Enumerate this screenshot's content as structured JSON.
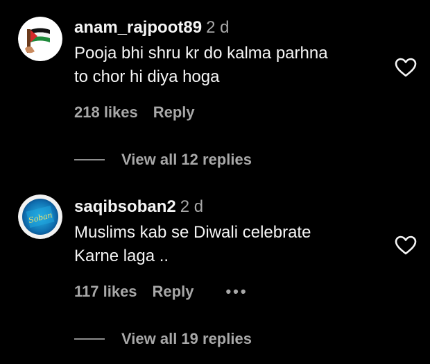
{
  "comments": [
    {
      "username": "anam_rajpoot89",
      "timestamp": "2 d",
      "text_lines": [
        "Pooja bhi shru kr do kalma parhna",
        "to chor hi diya hoga"
      ],
      "likes": "218 likes",
      "reply_label": "Reply",
      "view_replies": "View all 12 replies",
      "avatar_icon": "palestine-flag-icon"
    },
    {
      "username": "saqibsoban2",
      "timestamp": "2 d",
      "text_lines": [
        "Muslims kab se Diwali celebrate",
        "Karne laga .."
      ],
      "likes": "117 likes",
      "reply_label": "Reply",
      "more_options": "•••",
      "view_replies": "View all 19 replies",
      "avatar_icon": "soban-logo-icon",
      "avatar_text": "Soban"
    }
  ],
  "colors": {
    "background": "#000000",
    "primary_text": "#f5f5f5",
    "secondary_text": "#a8a8a8",
    "divider": "#8e8e8e"
  }
}
